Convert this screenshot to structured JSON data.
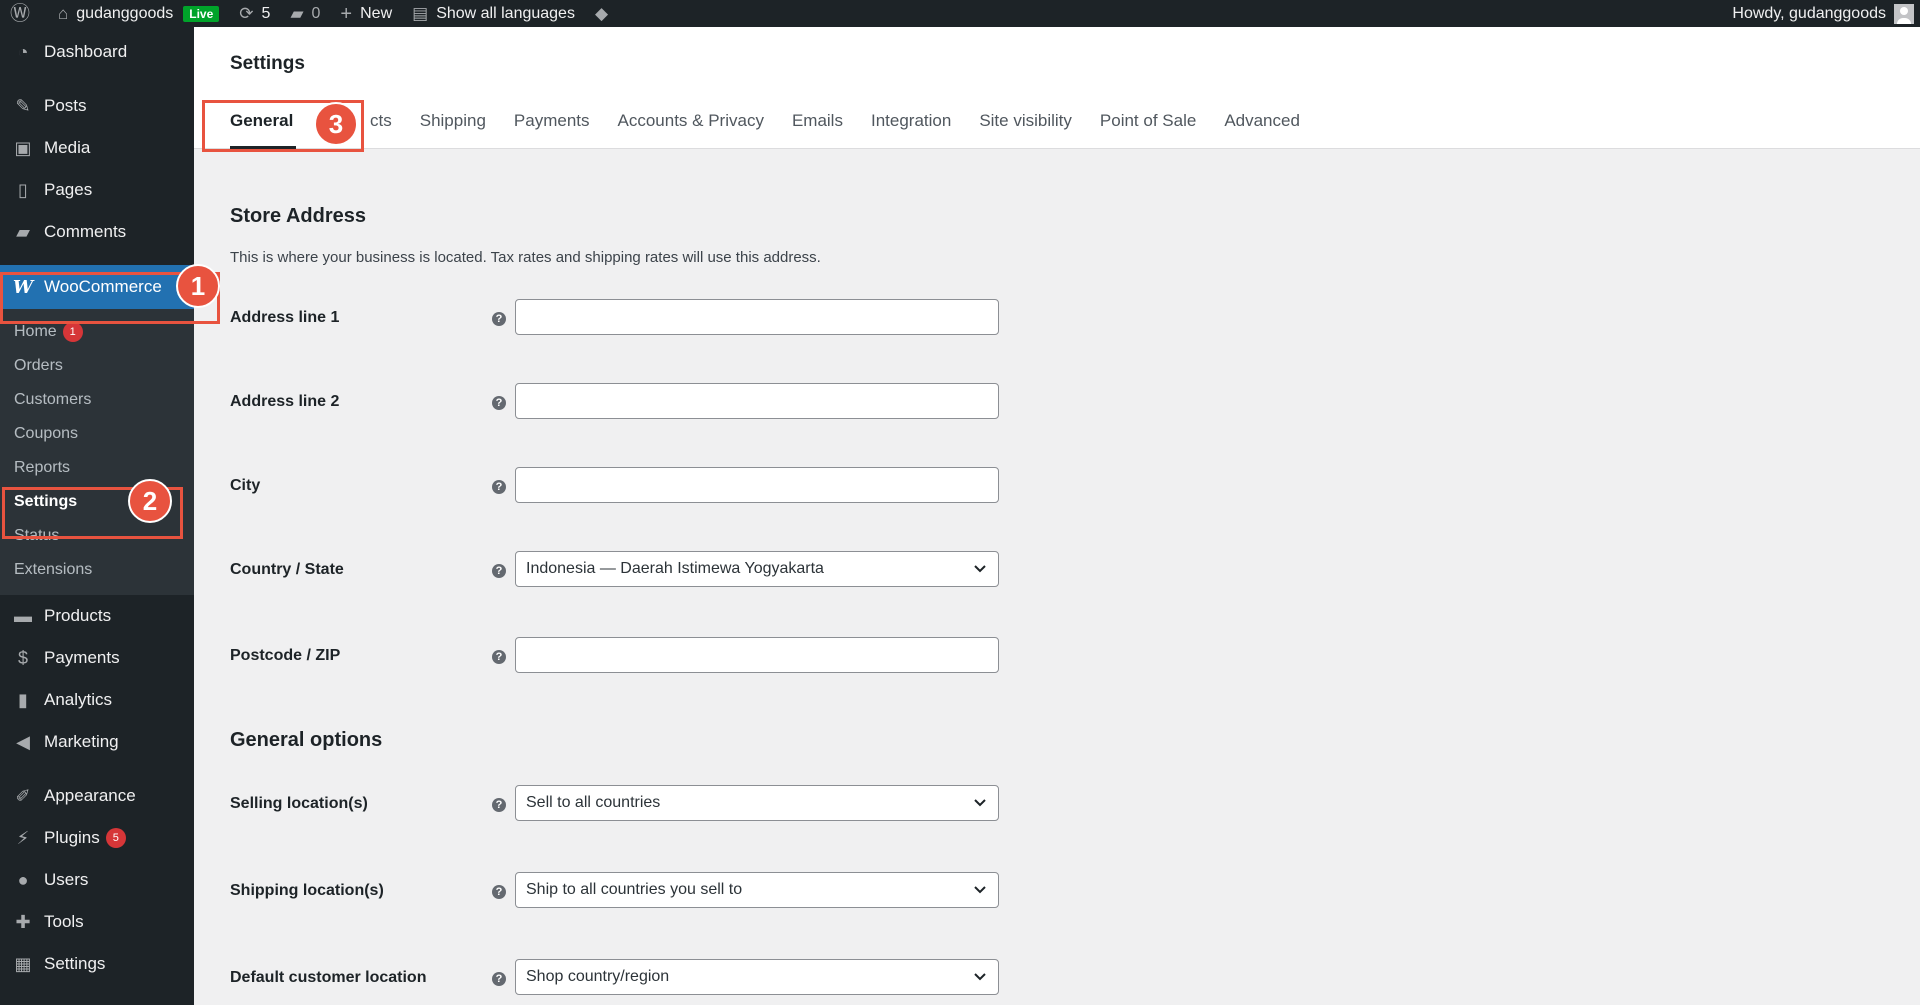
{
  "adminbar": {
    "site_name": "gudanggoods",
    "live_label": "Live",
    "updates_count": "5",
    "comments_count": "0",
    "new_label": "New",
    "languages_label": "Show all languages",
    "howdy": "Howdy, gudanggoods"
  },
  "sidebar": {
    "items_top": [
      {
        "label": "Dashboard",
        "icon": "dashboard-icon"
      },
      {
        "label": "Posts",
        "icon": "pin-icon"
      },
      {
        "label": "Media",
        "icon": "media-icon"
      },
      {
        "label": "Pages",
        "icon": "pages-icon"
      },
      {
        "label": "Comments",
        "icon": "comment-icon"
      },
      {
        "label": "WooCommerce",
        "icon": "woocommerce-icon"
      }
    ],
    "woo_submenu": [
      {
        "label": "Home",
        "badge": "1"
      },
      {
        "label": "Orders"
      },
      {
        "label": "Customers"
      },
      {
        "label": "Coupons"
      },
      {
        "label": "Reports"
      },
      {
        "label": "Settings"
      },
      {
        "label": "Status"
      },
      {
        "label": "Extensions"
      }
    ],
    "items_bottom": [
      {
        "label": "Products",
        "icon": "products-icon"
      },
      {
        "label": "Payments",
        "icon": "payments-icon"
      },
      {
        "label": "Analytics",
        "icon": "analytics-icon"
      },
      {
        "label": "Marketing",
        "icon": "megaphone-icon"
      },
      {
        "label": "Appearance",
        "icon": "brush-icon"
      },
      {
        "label": "Plugins",
        "icon": "plugin-icon",
        "badge": "5"
      },
      {
        "label": "Users",
        "icon": "user-icon"
      },
      {
        "label": "Tools",
        "icon": "wrench-icon"
      },
      {
        "label": "Settings",
        "icon": "settings-icon"
      }
    ]
  },
  "header": {
    "title": "Settings",
    "tabs": [
      "General",
      "Products",
      "Shipping",
      "Payments",
      "Accounts & Privacy",
      "Emails",
      "Integration",
      "Site visibility",
      "Point of Sale",
      "Advanced"
    ],
    "tab_0_visible": "General",
    "tab_1_visible": "cts"
  },
  "store_address": {
    "title": "Store Address",
    "description": "This is where your business is located. Tax rates and shipping rates will use this address.",
    "fields": [
      {
        "label": "Address line 1",
        "value": ""
      },
      {
        "label": "Address line 2",
        "value": ""
      },
      {
        "label": "City",
        "value": ""
      },
      {
        "label": "Country / State",
        "value": "Indonesia — Daerah Istimewa Yogyakarta"
      },
      {
        "label": "Postcode / ZIP",
        "value": ""
      }
    ]
  },
  "general_options": {
    "title": "General options",
    "fields": [
      {
        "label": "Selling location(s)",
        "value": "Sell to all countries"
      },
      {
        "label": "Shipping location(s)",
        "value": "Ship to all countries you sell to"
      },
      {
        "label": "Default customer location",
        "value": "Shop country/region"
      }
    ]
  },
  "annotations": [
    "1",
    "2",
    "3"
  ],
  "colors": {
    "accent": "#2271b1",
    "annotation": "#e8533f",
    "badge": "#d63638",
    "live": "#00a32a"
  }
}
